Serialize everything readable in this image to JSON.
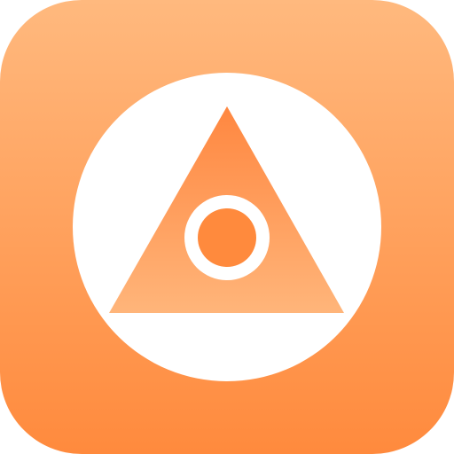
{
  "app_icon": {
    "icon": "triangle-with-eye-icon",
    "colors": {
      "background_top": "#FFB97E",
      "background_bottom": "#FF8A3D",
      "disc": "#FFFFFF",
      "triangle_top": "#FF8740",
      "triangle_bottom": "#FFB57A",
      "ring": "#FFFFFF",
      "pupil": "#FF8A3D"
    }
  }
}
